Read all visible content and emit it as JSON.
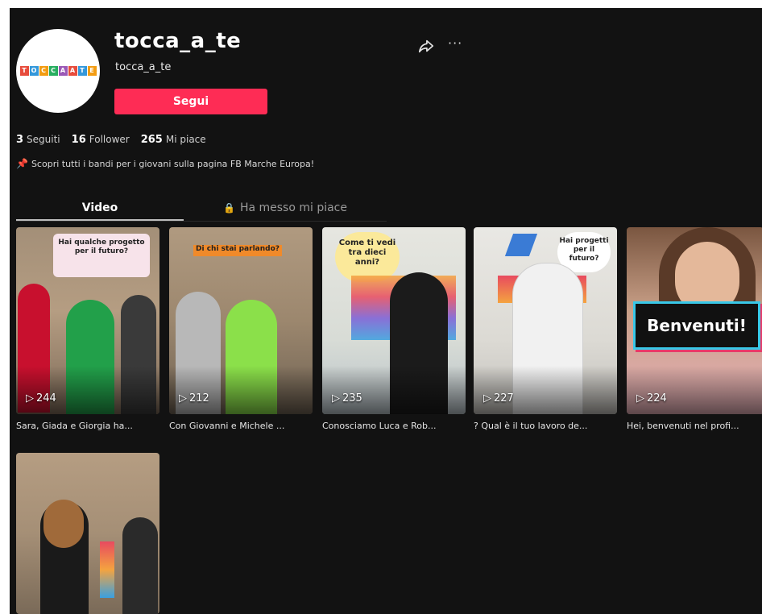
{
  "profile": {
    "username": "tocca_a_te",
    "handle": "tocca_a_te",
    "follow_label": "Segui",
    "logo_letters": [
      "T",
      "O",
      "C",
      "C",
      "A",
      "A",
      "T",
      "E"
    ],
    "logo_colors": [
      "#e74c3c",
      "#3498db",
      "#f39c12",
      "#27ae60",
      "#9b59b6",
      "#e74c3c",
      "#3498db",
      "#f39c12"
    ],
    "bio": "Scopri tutti i bandi per i giovani sulla pagina FB Marche Europa!"
  },
  "stats": {
    "following_count": "3",
    "following_label": "Seguiti",
    "followers_count": "16",
    "followers_label": "Follower",
    "likes_count": "265",
    "likes_label": "Mi piace"
  },
  "tabs": {
    "video_label": "Video",
    "liked_label": "Ha messo mi piace"
  },
  "videos": [
    {
      "views": "244",
      "caption": "Sara, Giada e Giorgia ha...",
      "bubble": "Hai qualche progetto per il futuro?"
    },
    {
      "views": "212",
      "caption": "Con Giovanni e Michele ...",
      "bubble": "Di chi stai parlando?"
    },
    {
      "views": "235",
      "caption": "Conosciamo Luca e Rob...",
      "bubble": "Come ti vedi tra dieci anni?"
    },
    {
      "views": "227",
      "caption": "? Qual è il tuo lavoro de...",
      "bubble": "Hai progetti per il futuro?"
    },
    {
      "views": "224",
      "caption": "Hei, benvenuti nel profi...",
      "bubble": "Benvenuti!"
    },
    {
      "views": "",
      "caption": "",
      "bubble": ""
    }
  ],
  "colors": {
    "accent": "#fe2c55",
    "background": "#121212"
  }
}
